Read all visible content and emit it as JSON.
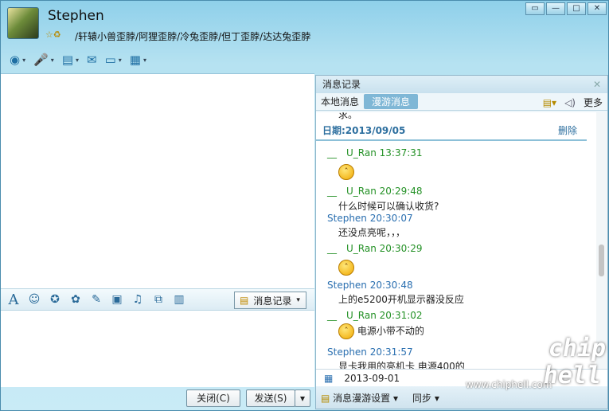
{
  "contact": {
    "name": "Stephen",
    "signature": "/轩辕小兽歪脖/阿狸歪脖/冷兔歪脖/但丁歪脖/达达兔歪脖",
    "status_icons": "☆♻"
  },
  "window_buttons": [
    "▭",
    "—",
    "□",
    "✕"
  ],
  "toolbar": {
    "tools": [
      "video-icon",
      "voice-icon",
      "file-icon",
      "sms-icon",
      "screen-share-icon",
      "apps-icon"
    ]
  },
  "format_bar": {
    "font": "A",
    "message_record_label": "消息记录"
  },
  "bottom": {
    "close_label": "关闭(C)",
    "send_label": "发送(S)",
    "send_dd": "▾"
  },
  "history": {
    "title": "消息记录",
    "tabs": {
      "local": "本地消息",
      "roaming": "漫游消息"
    },
    "more_label": "更多",
    "top_fragment": "求。",
    "date_label": "日期:2013/09/05",
    "delete_label": "删除",
    "messages": [
      {
        "header": "__　U_Ran 13:37:31",
        "text": "",
        "emoji": true
      },
      {
        "header": "__　U_Ran 20:29:48",
        "text": "什么时候可以确认收货?",
        "emoji": false
      },
      {
        "header": "Stephen 20:30:07",
        "text": "还没点亮呢，，，",
        "emoji": false,
        "self": true
      },
      {
        "header": "__　U_Ran 20:30:29",
        "text": "",
        "emoji": true
      },
      {
        "header": "Stephen 20:30:48",
        "text": "上的e5200开机显示器没反应",
        "emoji": false,
        "self": true
      },
      {
        "header": "__　U_Ran 20:31:02",
        "text": "电源小带不动的",
        "emoji": true
      },
      {
        "header": "Stephen 20:31:57",
        "text": "显卡我用的亮机卡  电源400的",
        "emoji": false,
        "self": true
      }
    ],
    "calendar_date": "2013-09-01",
    "footer": {
      "roaming_settings": "消息漫游设置 ▾",
      "sync": "同步 ▾"
    }
  },
  "watermark": {
    "text": "www.chiphell.com",
    "logo": "chip hell"
  }
}
